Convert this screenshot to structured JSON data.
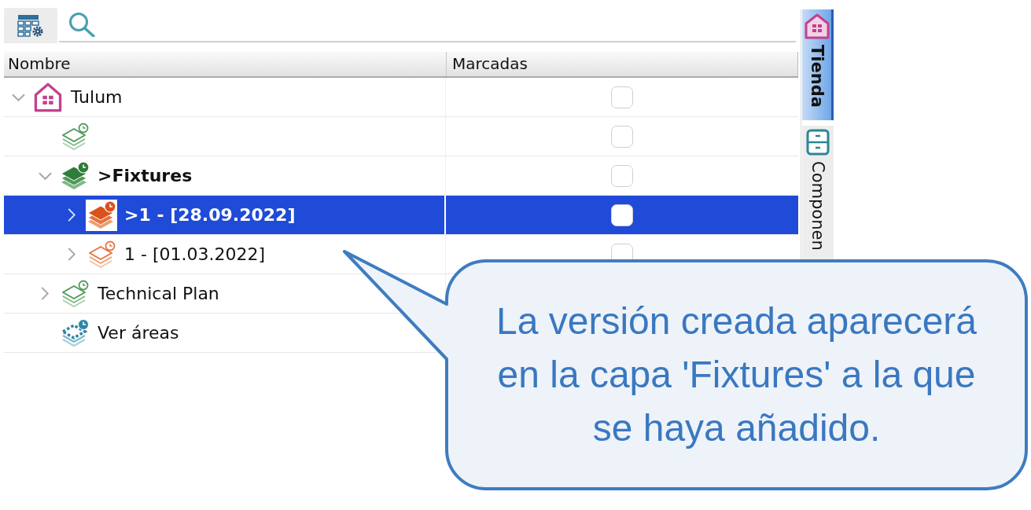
{
  "table": {
    "columns": [
      "Nombre",
      "Marcadas"
    ],
    "rows": [
      {
        "kind": "store",
        "label": "Tulum",
        "expanded": true,
        "active": false,
        "selected": false,
        "checked": false,
        "children": [
          {
            "kind": "layer",
            "active": false,
            "selected": false,
            "checked": false
          },
          {
            "kind": "layer",
            "label": ">Fixtures",
            "expanded": true,
            "active": true,
            "selected": false,
            "checked": false,
            "children": [
              {
                "kind": "version",
                "label": ">1 - [28.09.2022]",
                "expanded": false,
                "active": true,
                "selected": true,
                "checked": false
              },
              {
                "kind": "version",
                "label": "1 - [01.03.2022]",
                "expanded": false,
                "active": false,
                "selected": false,
                "checked": false
              }
            ]
          },
          {
            "kind": "layer",
            "label": "Technical Plan",
            "expanded": false,
            "active": false,
            "selected": false
          },
          {
            "kind": "areas",
            "label": "Ver áreas",
            "active": false,
            "selected": false
          }
        ]
      }
    ]
  },
  "side_tabs": [
    {
      "kind": "store",
      "label": "Tienda",
      "selected": true
    },
    {
      "kind": "components",
      "label": "Componen",
      "selected": false
    }
  ],
  "callout": {
    "text": "La versión creada aparecerá en la capa 'Fixtures' a la que se haya añadido."
  }
}
